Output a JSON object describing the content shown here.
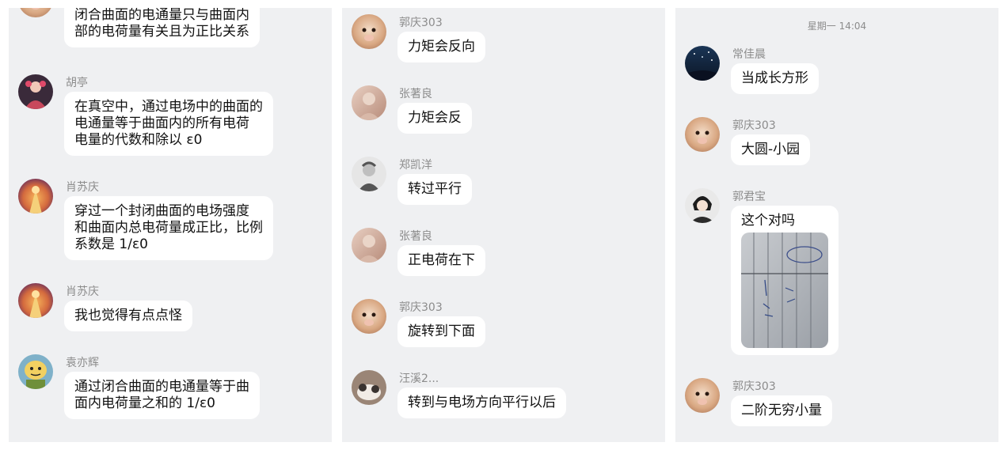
{
  "panels": [
    {
      "messages": [
        {
          "name": "",
          "avatar": "hamster-avatar",
          "lines": [
            "闭合曲面的电通量只与曲面内",
            "部的电荷量有关且为正比关系"
          ]
        },
        {
          "name": "胡亭",
          "avatar": "costume-avatar",
          "lines": [
            "在真空中，通过电场中的曲面的",
            "电通量等于曲面内的所有电荷",
            "电量的代数和除以 ε0"
          ]
        },
        {
          "name": "肖苏庆",
          "avatar": "sunset-avatar",
          "lines": [
            "穿过一个封闭曲面的电场强度",
            "和曲面内总电荷量成正比，比例",
            "系数是 1/ε0"
          ]
        },
        {
          "name": "肖苏庆",
          "avatar": "sunset-avatar",
          "lines": [
            "我也觉得有点点怪"
          ]
        },
        {
          "name": "袁亦辉",
          "avatar": "cartoon-face-avatar",
          "lines": [
            "通过闭合曲面的电通量等于曲",
            "面内电荷量之和的 1/ε0"
          ]
        }
      ]
    },
    {
      "messages": [
        {
          "name": "郭庆303",
          "avatar": "hamster-avatar",
          "lines": [
            "力矩会反向"
          ]
        },
        {
          "name": "张著良",
          "avatar": "portrait-avatar",
          "lines": [
            "力矩会反"
          ]
        },
        {
          "name": "郑凯洋",
          "avatar": "sketch-avatar",
          "lines": [
            "转过平行"
          ]
        },
        {
          "name": "张著良",
          "avatar": "portrait-avatar",
          "lines": [
            "正电荷在下"
          ]
        },
        {
          "name": "郭庆303",
          "avatar": "hamster-avatar",
          "lines": [
            "旋转到下面"
          ]
        },
        {
          "name": "汪溪2...",
          "avatar": "cat-avatar",
          "lines": [
            "转到与电场方向平行以后"
          ]
        }
      ]
    },
    {
      "timestamp": "星期一 14:04",
      "messages": [
        {
          "name": "常佳晨",
          "avatar": "night-sky-avatar",
          "lines": [
            "当成长方形"
          ]
        },
        {
          "name": "郭庆303",
          "avatar": "hamster-avatar",
          "lines": [
            "大圆-小园"
          ]
        },
        {
          "name": "郭君宝",
          "avatar": "anime-avatar",
          "lines": [
            "这个对吗"
          ],
          "image": "notebook-photo"
        },
        {
          "name": "郭庆303",
          "avatar": "hamster-avatar",
          "lines": [
            "二阶无穷小量"
          ]
        }
      ]
    }
  ]
}
